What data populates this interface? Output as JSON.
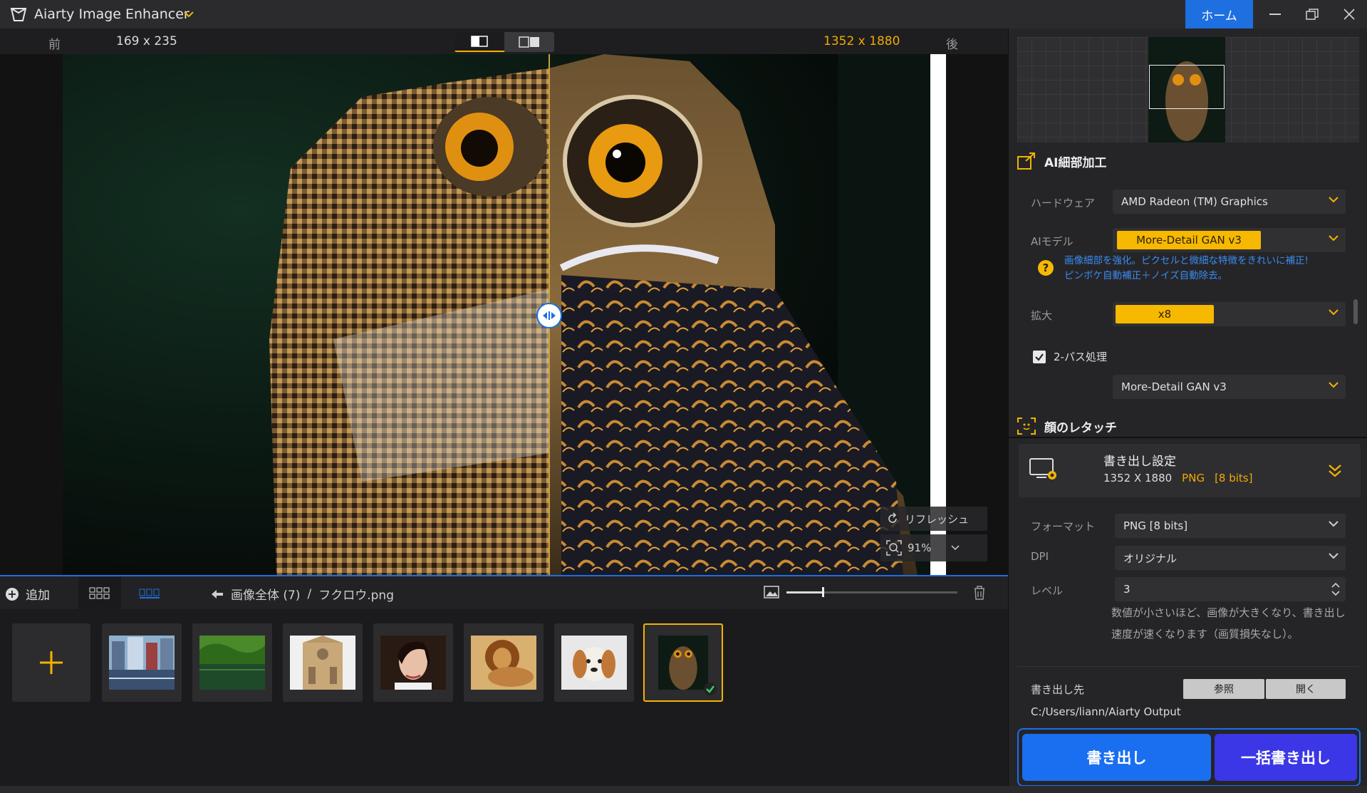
{
  "app": {
    "title": "Aiarty Image Enhancer",
    "home_label": "ホーム"
  },
  "compare": {
    "before_label": "前",
    "before_size": "169 x 235",
    "after_size": "1352 x 1880",
    "after_label": "後"
  },
  "preview_tools": {
    "refresh_label": "リフレッシュ",
    "zoom_value": "91%"
  },
  "bottom_bar": {
    "add_label": "追加",
    "breadcrumb_all": "画像全体 (7)",
    "breadcrumb_sep": "/",
    "breadcrumb_file": "フクロウ.png"
  },
  "gallery": {
    "items": [
      {
        "name": "city"
      },
      {
        "name": "forest-lake"
      },
      {
        "name": "cathedral"
      },
      {
        "name": "woman-portrait"
      },
      {
        "name": "lion"
      },
      {
        "name": "dog"
      },
      {
        "name": "owl",
        "selected": true
      }
    ]
  },
  "ai_detail": {
    "section_title": "AI細部加工",
    "hardware_label": "ハードウェア",
    "hardware_value": "AMD Radeon (TM) Graphics",
    "model_label": "AIモデル",
    "model_value": "More-Detail GAN  v3",
    "model_help_line1": "画像細部を強化。ピクセルと微細な特徴をきれいに補正!",
    "model_help_line2": "ピンボケ自動補正＋ノイズ自動除去。",
    "scale_label": "拡大",
    "scale_value": "x8",
    "two_pass_label": "2-パス処理",
    "two_pass_model": "More-Detail GAN  v3"
  },
  "face": {
    "section_title": "顔のレタッチ"
  },
  "export": {
    "title": "書き出し設定",
    "size": "1352 X 1880",
    "format": "PNG",
    "bits": "[8 bits]",
    "format_label": "フォーマット",
    "format_value": "PNG   [8 bits]",
    "dpi_label": "DPI",
    "dpi_value": "オリジナル",
    "level_label": "レベル",
    "level_value": "3",
    "level_hint": "数値が小さいほど、画像が大きくなり、書き出し速度が速くなります（画質損失なし）。",
    "dest_label": "書き出し先",
    "browse_label": "参照",
    "open_label": "開く",
    "path": "C:/Users/liann/Aiarty Output",
    "export_button": "書き出し",
    "batch_button": "一括書き出し"
  },
  "colors": {
    "accent": "#f7b800",
    "primary": "#1a6ff0",
    "batch": "#3b37e6"
  }
}
